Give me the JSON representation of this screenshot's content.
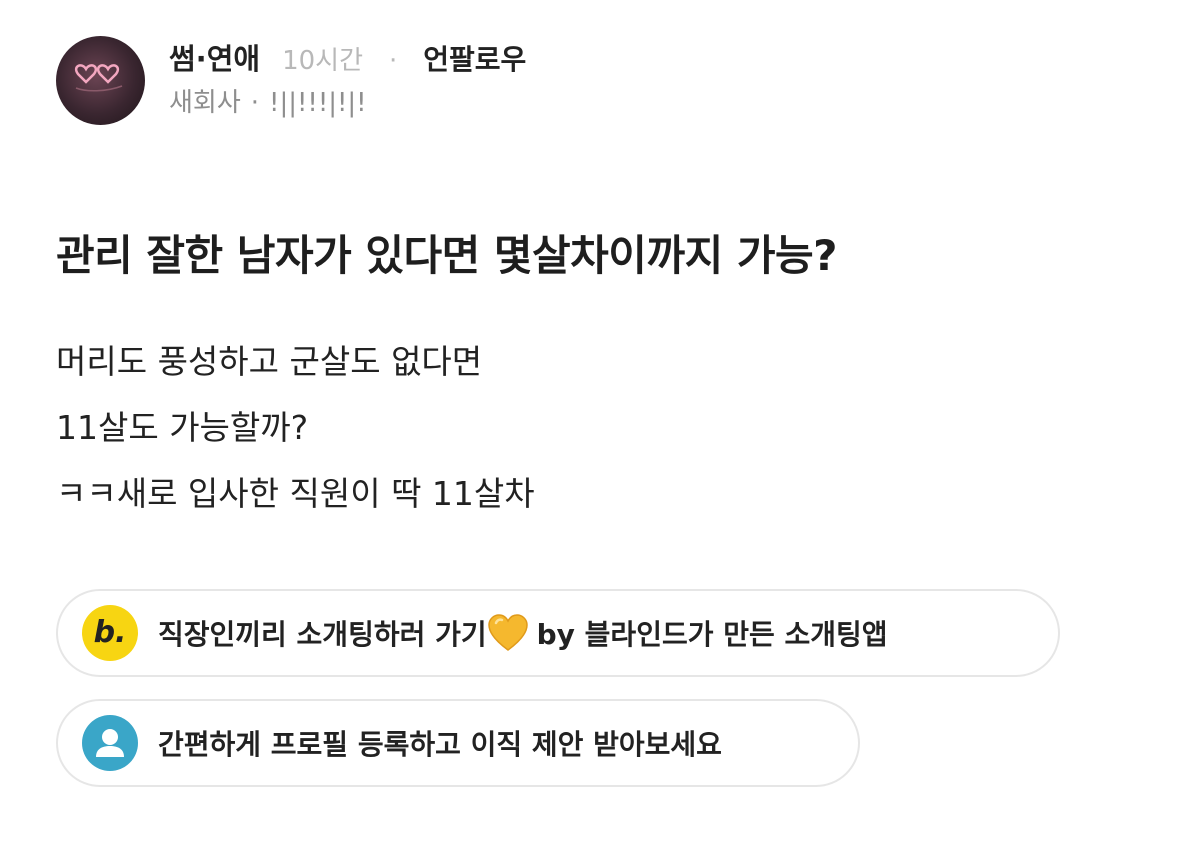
{
  "post": {
    "category": "썸·연애",
    "time": "10시간",
    "separator": "·",
    "follow_label": "언팔로우",
    "company": "새회사",
    "company_sep": "·",
    "nickname": "!||!!!|!|!",
    "title": "관리 잘한 남자가 있다면 몇살차이까지 가능?",
    "body_lines": [
      "머리도 풍성하고 군살도 없다면",
      "11살도 가능할까?",
      "ㅋㅋ새로 입사한 직원이 딱 11살차"
    ]
  },
  "promos": [
    {
      "icon": "blind-b-logo-icon",
      "icon_letter": "b.",
      "text_before": "직장인끼리 소개팅하러 가기",
      "emoji": "yellow-heart-icon",
      "text_after": "by 블라인드가 만든 소개팅앱"
    },
    {
      "icon": "user-profile-icon",
      "text": "간편하게 프로필 등록하고 이직 제안 받아보세요"
    }
  ],
  "colors": {
    "muted_text": "#b8b8b8",
    "secondary_text": "#8e8e8e",
    "blind_yellow": "#f7d512",
    "profile_blue": "#3aa6c8",
    "heart_yellow": "#f5b82e"
  }
}
